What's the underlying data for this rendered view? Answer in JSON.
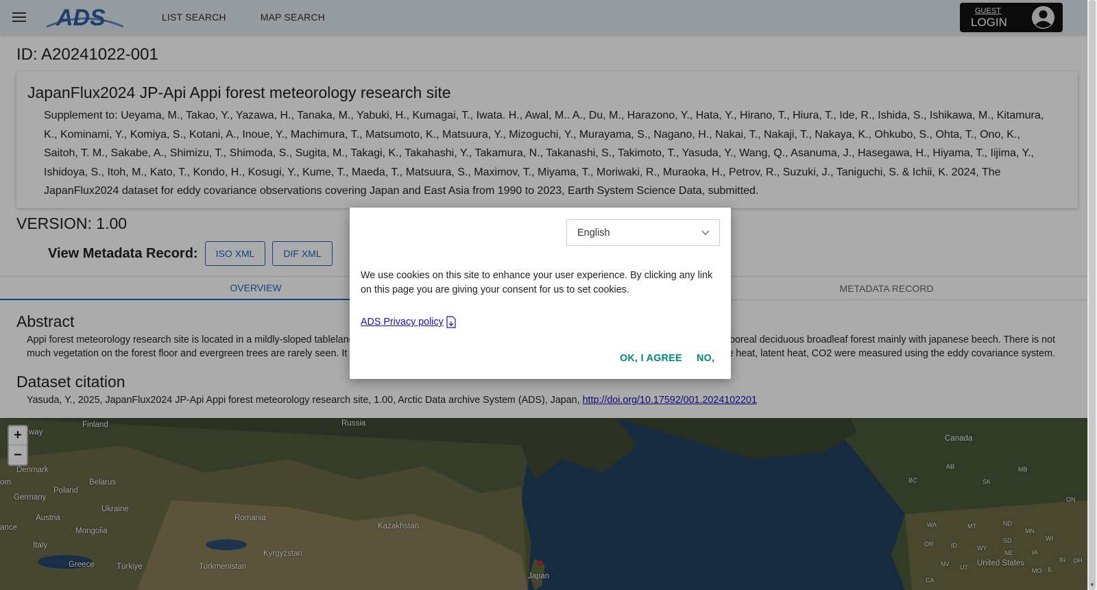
{
  "header": {
    "logo_text": "ADS",
    "nav": [
      "LIST SEARCH",
      "MAP SEARCH"
    ],
    "login": {
      "guest_label": "GUEST",
      "login_label": "LOGIN"
    }
  },
  "record": {
    "id_label": "ID: A20241022-001",
    "title": "JapanFlux2024 JP-Api Appi forest meteorology research site",
    "supplement": "Supplement to: Ueyama, M., Takao, Y., Yazawa, H., Tanaka, M., Yabuki, H., Kumagai, T., Iwata. H., Awal, M.. A., Du, M., Harazono, Y., Hata, Y., Hirano, T., Hiura, T., Ide, R., Ishida, S., Ishikawa, M., Kitamura, K., Kominami, Y., Komiya, S., Kotani, A., Inoue, Y., Machimura, T., Matsumoto, K., Matsuura, Y., Mizoguchi, Y., Murayama, S., Nagano, H., Nakai, T., Nakaji, T., Nakaya, K., Ohkubo, S., Ohta, T., Ono, K., Saitoh, T. M., Sakabe, A., Shimizu, T., Shimoda, S., Sugita, M., Takagi, K., Takahashi, Y., Takamura, N., Takanashi, S., Takimoto, T., Yasuda, Y., Wang, Q., Asanuma, J., Hasegawa, H., Hiyama, T., Iijima, Y., Ishidoya, S., Itoh, M., Kato, T., Kondo, H., Kosugi, Y., Kume, T., Maeda, T., Matsuura, S., Maximov, T., Miyama, T., Moriwaki, R., Muraoka, H., Petrov, R., Suzuki, J., Taniguchi, S. & Ichii, K. 2024, The JapanFlux2024 dataset for eddy covariance observations covering Japan and East Asia from 1990 to 2023, Earth System Science Data, submitted.",
    "version_label": "VERSION: 1.00",
    "metadata_label": "View Metadata Record:",
    "metadata_buttons": [
      "ISO XML",
      "DIF XML"
    ]
  },
  "tabs": [
    "OVERVIEW",
    "METADATA RECORD"
  ],
  "abstract": {
    "heading": "Abstract",
    "line1_left": "Appi forest meteorology research site is located in a mildly-sloped tableland",
    "line1_right": "t of boreal deciduous broadleaf forest mainly with japanese beech. There is not",
    "line2_left": "much vegetation on the forest floor and evergreen trees are rarely seen. It sn",
    "line2_right": "nsible heat, latent heat, CO2 were measured using the eddy covariance system."
  },
  "citation": {
    "heading": "Dataset citation",
    "text": "Yasuda, Y., 2025, JapanFlux2024 JP-Api Appi forest meteorology research site, 1.00, Arctic Data archive System (ADS), Japan, ",
    "link": "http://doi.org/10.17592/001.2024102201"
  },
  "map": {
    "zoom_in": "+",
    "zoom_out": "−",
    "labels": [
      "Finland",
      "way",
      "Russia",
      "Canada",
      "Denmark",
      "Belarus",
      "Poland",
      "Germany",
      "Ukraine",
      "Austria",
      "Romania",
      "Kazakhstan",
      "Mongolia",
      "Italy",
      "Kyrgyzstan",
      "Greece",
      "Türkiye",
      "Turkmenistan",
      "Japan",
      "ance",
      "om",
      "United States"
    ],
    "small_labels": [
      "AB",
      "MB",
      "BC",
      "SK",
      "ON",
      "WA",
      "MT",
      "ND",
      "MN",
      "OR",
      "ID",
      "WY",
      "SD",
      "WI",
      "NE",
      "IA",
      "NV",
      "UT",
      "IN",
      "OH",
      "MO",
      "IL",
      "CA"
    ]
  },
  "cookie_modal": {
    "language": "English",
    "consent_text": "We use cookies on this site to enhance your user experience. By clicking any link on this page you are giving your consent for us to set cookies.",
    "privacy_link": "ADS Privacy policy",
    "agree_label": "OK, I AGREE",
    "no_label": "NO,"
  },
  "colors": {
    "accent": "#1565c0",
    "modal_button": "#00897b",
    "header_bg": "#dfe7ee"
  }
}
